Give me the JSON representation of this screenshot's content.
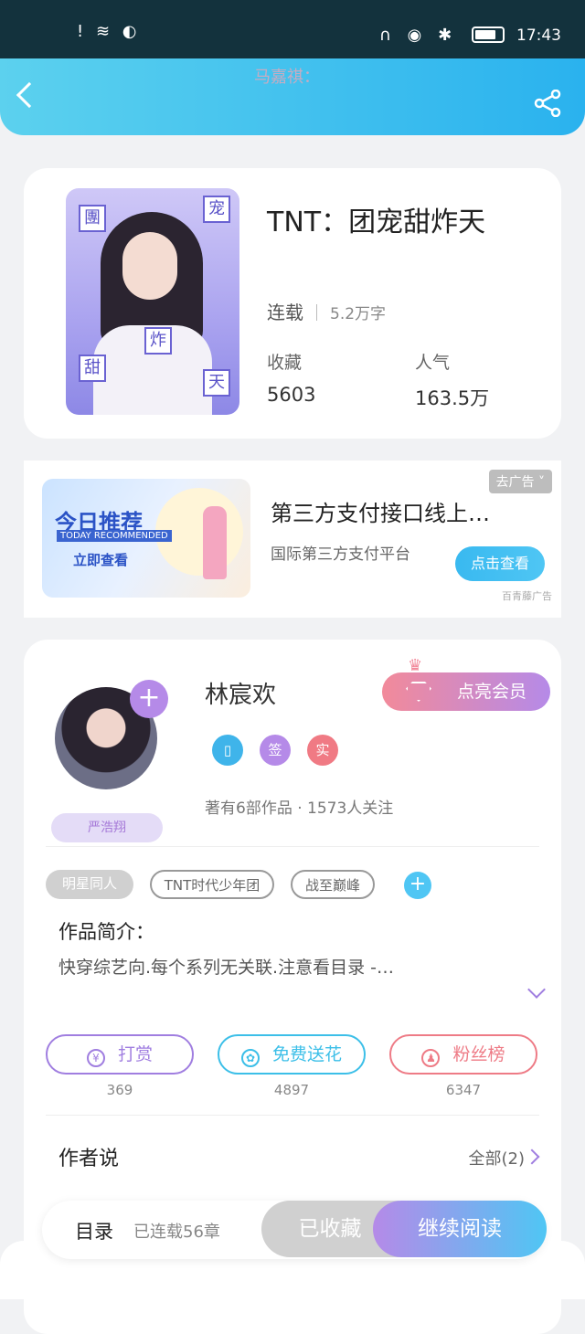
{
  "status_bar": {
    "time": "17:43",
    "left_icons": "! ≋ ◐",
    "right_icons": "∩ ◉ ✱"
  },
  "header": {
    "title": "马嘉祺："
  },
  "book": {
    "title": "TNT：团宠甜炸天",
    "status": "连载",
    "word_count": "5.2万字",
    "favorites_label": "收藏",
    "favorites_value": "5603",
    "popularity_label": "人气",
    "popularity_value": "163.5万",
    "cover_tiles": [
      "團",
      "宠",
      "甜",
      "炸",
      "天"
    ]
  },
  "ad": {
    "tag": "去广告 ˅",
    "title": "第三方支付接口线上…",
    "desc": "国际第三方支付平台",
    "button": "点击查看",
    "source": "百青藤广告",
    "img_title": "今日推荐",
    "img_sub": "TODAY RECOMMENDED",
    "img_cta": "立即查看"
  },
  "author": {
    "name": "林宸欢",
    "vip_button": "点亮会员",
    "badges": [
      "▯",
      "签",
      "实"
    ],
    "works": "著有6部作品 · 1573人关注",
    "fan_badge": "严浩翔",
    "plus": "+"
  },
  "tags": [
    "明星同人",
    "TNT时代少年团",
    "战至巅峰"
  ],
  "intro": {
    "heading": "作品简介：",
    "text": "快穿综艺向.每个系列无关联.注意看目录 -…"
  },
  "actions": [
    {
      "label": "打赏",
      "icon": "¥",
      "count": "369",
      "color": "#a07ee0"
    },
    {
      "label": "免费送花",
      "icon": "✿",
      "count": "4897",
      "color": "#3cbfe8"
    },
    {
      "label": "粉丝榜",
      "icon": "♟",
      "count": "6347",
      "color": "#ee7b86"
    }
  ],
  "author_says": {
    "heading": "作者说",
    "all": "全部(2)"
  },
  "bottom": {
    "toc": "目录",
    "chapters": "已连载56章",
    "favorited": "已收藏",
    "continue": "继续阅读"
  }
}
